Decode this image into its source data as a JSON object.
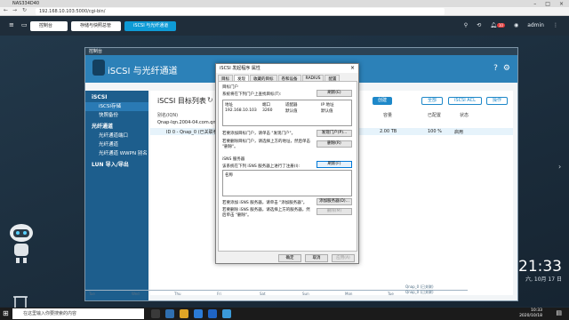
{
  "browser": {
    "tab_title": "NAS334D40",
    "url": "192.168.10.103:5000/cgi-bin/"
  },
  "nas_bar": {
    "tabs": [
      "控制台",
      "存储与快照总管",
      "iSCSI 与光纤通道"
    ],
    "notification_count": "10",
    "user": "admin"
  },
  "app": {
    "window_title": "控制台",
    "name": "iSCSI 与光纤通道",
    "sidebar": {
      "sections": [
        {
          "label": "iSCSI",
          "items": [
            "iSCSI存储",
            "快照备份"
          ]
        },
        {
          "label": "光纤通道",
          "items": [
            "光纤通道端口",
            "光纤通道",
            "光纤通道 WWPN 别名"
          ]
        },
        {
          "label": "LUN 导入/导出",
          "items": []
        }
      ]
    },
    "content": {
      "title": "iSCSI 目标列表",
      "col_alias": "别名(IQN)",
      "col_capacity": "容量",
      "col_used": "已配置",
      "col_status": "状态",
      "row_target": "Qnap-Iqn.2004-04.com.qna...",
      "row_lun": "ID 0 - Qnap_0 (已关联卷)",
      "row_lun_size": "2.00 TB",
      "row_lun_pct": "100 %",
      "row_lun_status": "启用",
      "btn_create": "创建",
      "btn_all": "全部",
      "btn_acl": "iSCSI ACL",
      "btn_action": "操作"
    },
    "chart_ticks": [
      "Tue",
      "Wed",
      "Thu",
      "Fri",
      "Sat",
      "Sun",
      "Mon",
      "Tue"
    ],
    "chart_legend": [
      "Qnap_0 (已关联)",
      "Qnap_0 (已关联)"
    ]
  },
  "dialog": {
    "title": "iSCSI 发起程序 属性",
    "close": "×",
    "tabs": [
      "目标",
      "发现",
      "收藏的目标",
      "卷和设备",
      "RADIUS",
      "配置"
    ],
    "portal_group": "目标门户",
    "portal_desc": "系统将在下列门户上查找目标(T):",
    "refresh_btn": "刷新(E)",
    "portal_cols": [
      "地址",
      "端口",
      "适配器",
      "IP 地址"
    ],
    "portal_row": [
      "192.168.10.103",
      "3260",
      "默认值",
      "默认值"
    ],
    "portal_add_text": "若要添加目标门户，请单击 \"发现门户\"。",
    "portal_add_btn": "发现门户(P)...",
    "portal_remove_text": "若要删除目标门户，请选择上方的地址，然后单击 \"删除\"。",
    "portal_remove_btn": "删除(R)",
    "isns_group": "iSNS 服务器",
    "isns_desc": "该系统在下列 iSNS 服务器上进行了注册(I):",
    "isns_refresh_btn": "刷新(F)",
    "isns_col": "名称",
    "isns_add_text": "若要添加 iSNS 服务器，请单击 \"添加服务器\"。",
    "isns_add_btn": "添加服务器(D)...",
    "isns_remove_text": "若要删除 iSNS 服务器，请选择上方的服务器，然后单击 \"删除\"。",
    "isns_remove_btn": "删除(M)",
    "ok": "确定",
    "cancel": "取消",
    "apply": "应用(A)"
  },
  "desktop": {
    "time": "21:33",
    "date": "六, 10月 17 日"
  },
  "taskbar": {
    "search_placeholder": "在这里输入你要搜索的内容",
    "tray_time": "10:33",
    "tray_date": "2020/10/18"
  }
}
